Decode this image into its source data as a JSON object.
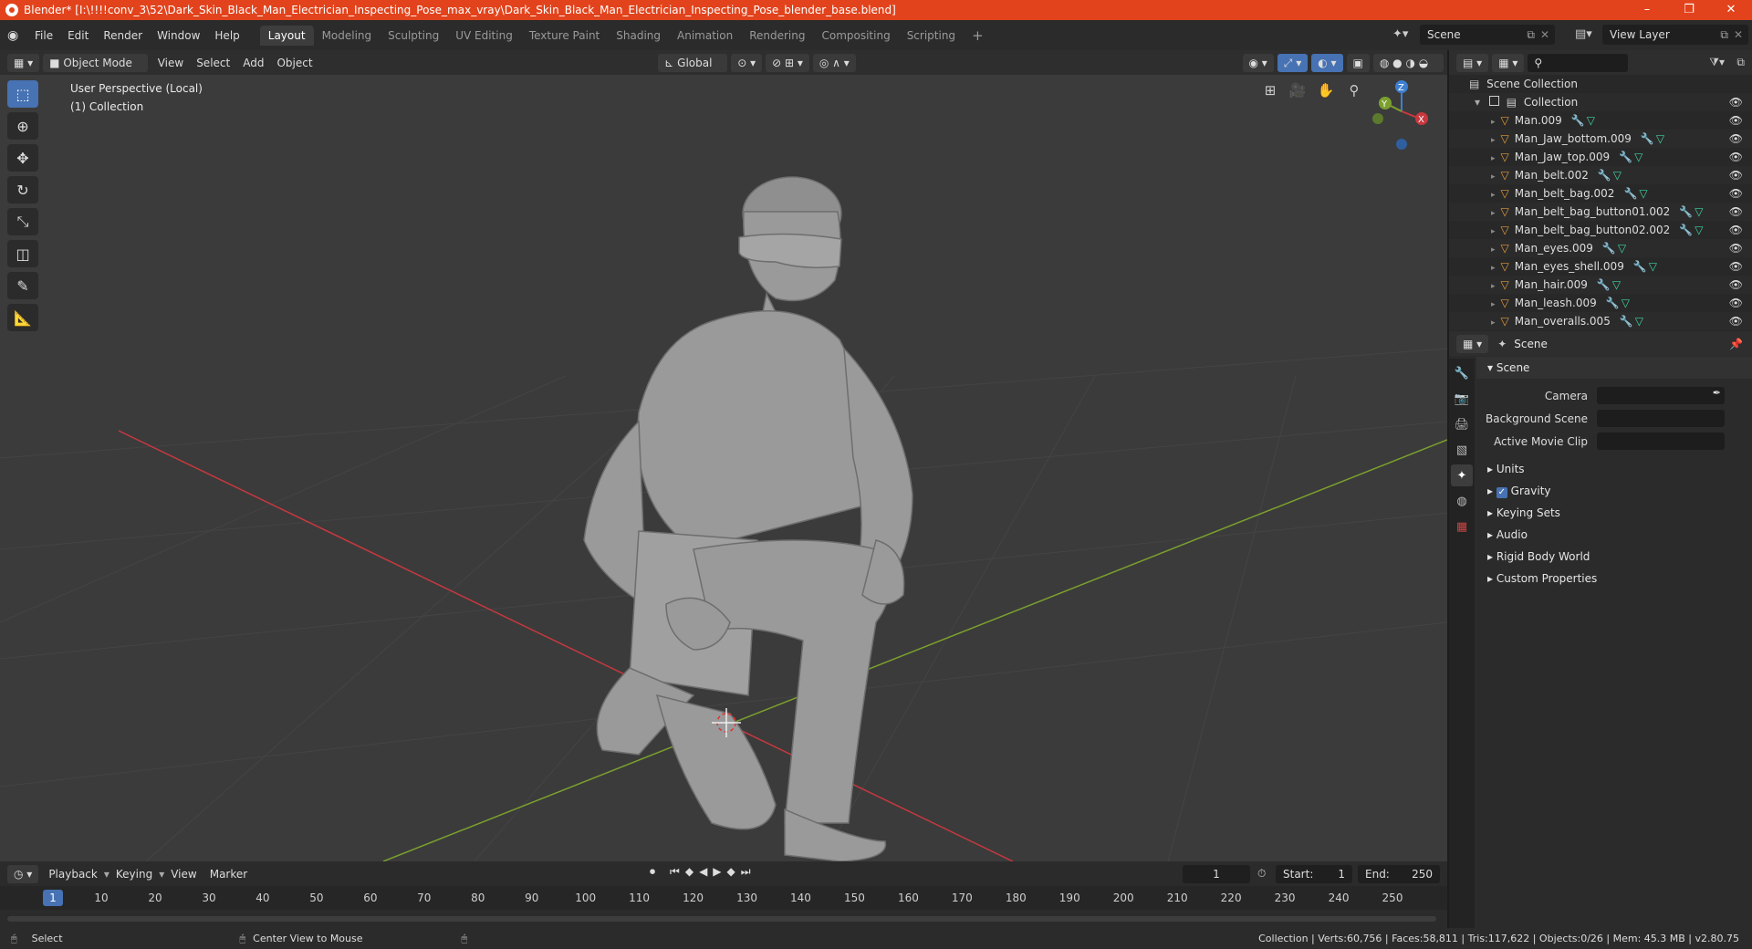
{
  "window": {
    "title": "Blender* [I:\\!!!!conv_3\\52\\Dark_Skin_Black_Man_Electrician_Inspecting_Pose_max_vray\\Dark_Skin_Black_Man_Electrician_Inspecting_Pose_blender_base.blend]",
    "controls": [
      "–",
      "❐",
      "✕"
    ]
  },
  "topbar": {
    "menus": [
      "File",
      "Edit",
      "Render",
      "Window",
      "Help"
    ],
    "workspaces": [
      "Layout",
      "Modeling",
      "Sculpting",
      "UV Editing",
      "Texture Paint",
      "Shading",
      "Animation",
      "Rendering",
      "Compositing",
      "Scripting"
    ],
    "active_workspace": "Layout",
    "add_tab": "+",
    "scene": "Scene",
    "view_layer": "View Layer"
  },
  "viewport_header": {
    "mode": "Object Mode",
    "menus": [
      "View",
      "Select",
      "Add",
      "Object"
    ],
    "transform_orientation": "Global"
  },
  "viewport": {
    "perspective_label": "User Perspective (Local)",
    "collection_label": "(1) Collection",
    "gizmo_axes": [
      "X",
      "Y",
      "Z"
    ]
  },
  "outliner": {
    "root": "Scene Collection",
    "collection": "Collection",
    "items": [
      "Man.009",
      "Man_Jaw_bottom.009",
      "Man_Jaw_top.009",
      "Man_belt.002",
      "Man_belt_bag.002",
      "Man_belt_bag_button01.002",
      "Man_belt_bag_button02.002",
      "Man_eyes.009",
      "Man_eyes_shell.009",
      "Man_hair.009",
      "Man_leash.009",
      "Man_overalls.005"
    ]
  },
  "properties": {
    "header": "Scene",
    "panel_title": "Scene",
    "fields": [
      {
        "label": "Camera"
      },
      {
        "label": "Background Scene"
      },
      {
        "label": "Active Movie Clip"
      }
    ],
    "sections": [
      "Units",
      "Gravity",
      "Keying Sets",
      "Audio",
      "Rigid Body World",
      "Custom Properties"
    ],
    "gravity_checked": true
  },
  "timeline": {
    "menus": [
      "Playback",
      "Keying",
      "View",
      "Marker"
    ],
    "current_frame": "1",
    "start_label": "Start:",
    "start": "1",
    "end_label": "End:",
    "end": "250",
    "ruler": [
      "1",
      "10",
      "20",
      "30",
      "40",
      "50",
      "60",
      "70",
      "80",
      "90",
      "100",
      "110",
      "120",
      "130",
      "140",
      "150",
      "160",
      "170",
      "180",
      "190",
      "200",
      "210",
      "220",
      "230",
      "240",
      "250"
    ]
  },
  "statusbar": {
    "left": "Select",
    "middle": "Center View to Mouse",
    "stats": "Collection | Verts:60,756 | Faces:58,811 | Tris:117,622 | Objects:0/26 | Mem: 45.3 MB | v2.80.75"
  },
  "colors": {
    "titlebar": "#e2431c",
    "accent": "#4772b3",
    "x_axis": "#c8383f",
    "y_axis": "#7ba02e",
    "z_axis": "#3e7fd1"
  }
}
